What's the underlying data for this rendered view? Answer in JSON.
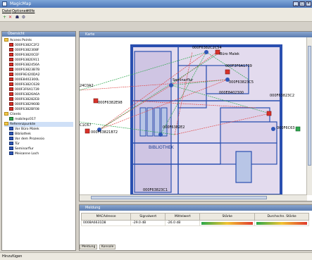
{
  "window": {
    "title": "MagicMap"
  },
  "menu": {
    "items": [
      "Datei",
      "Optionen",
      "Hilfe"
    ]
  },
  "left_panel": {
    "title": "Übersicht",
    "access_points_label": "Access Points",
    "access_points": [
      "000F6382C2F2",
      "000F6382308F",
      "000F63820CEF",
      "000F6382E911",
      "000F6382456A",
      "000F63823B7B",
      "000F9E420DA2",
      "000E8402300L",
      "000F6382C628",
      "000F3F6A1739",
      "000F63826A6A",
      "000F638282E8",
      "000F6382960B",
      "000F6382BF08"
    ],
    "clients_label": "Clients",
    "clients": [
      "mobilepc017"
    ],
    "refs_label": "Referenzpunkte",
    "refs": [
      "Vor Büro Malek",
      "Bibliothek",
      "Vor dem Prozessio",
      "Tür",
      "Seminarflur",
      "Meisanne Loch"
    ]
  },
  "map": {
    "title": "Karte",
    "labels": [
      "000F6382C2C54",
      "Büro Malek",
      "000F3F6A1739",
      "Seminarflur",
      "000F63823C5",
      "24C0A2",
      "000F6382E98",
      "000E8402300",
      "000F63821B72",
      "000F6382E2",
      "C1C67",
      "000F63823C2",
      "000F6C63",
      "000F63823C1",
      "BIBLIOTHEK"
    ]
  },
  "messages": {
    "title": "Meldung",
    "headers": [
      "MACAdresse",
      "Signalwert",
      "Mittelwert",
      "Stärke",
      "Durchschn. Stärke"
    ],
    "rows": [
      {
        "mac": "000BA6631D8",
        "signal": "-29.0 dB",
        "mean": "-26.0 dB"
      }
    ],
    "tabs": [
      "Meldung",
      "Konsole"
    ]
  },
  "status": {
    "text": "Hinzufügen"
  }
}
